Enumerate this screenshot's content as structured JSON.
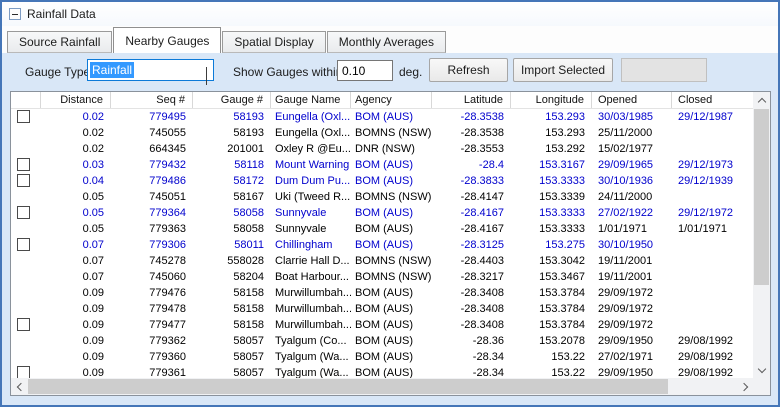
{
  "window": {
    "title": "Rainfall Data"
  },
  "tabs": [
    {
      "label": "Source Rainfall",
      "active": false
    },
    {
      "label": "Nearby Gauges",
      "active": true
    },
    {
      "label": "Spatial Display",
      "active": false
    },
    {
      "label": "Monthly Averages",
      "active": false
    }
  ],
  "toolbar": {
    "gauge_type_label": "Gauge Type",
    "gauge_type_value": "Rainfall",
    "show_within_label": "Show Gauges within",
    "show_within_value": "0.10",
    "unit_label": "deg.",
    "refresh_label": "Refresh",
    "import_label": "Import Selected"
  },
  "grid": {
    "columns": [
      "",
      "Distance",
      "Seq #",
      "Gauge #",
      "Gauge Name",
      "Agency",
      "Latitude",
      "Longitude",
      "Opened",
      "Closed"
    ],
    "rows": [
      {
        "selectable": true,
        "highlight": true,
        "distance": "0.02",
        "seq": "779495",
        "gauge_num": "58193",
        "gauge_name": "Eungella (Oxl...",
        "agency": "BOM (AUS)",
        "lat": "-28.3538",
        "lon": "153.293",
        "opened": "30/03/1985",
        "closed": "29/12/1987"
      },
      {
        "selectable": false,
        "highlight": false,
        "distance": "0.02",
        "seq": "745055",
        "gauge_num": "58193",
        "gauge_name": "Eungella (Oxl...",
        "agency": "BOMNS (NSW)",
        "lat": "-28.3538",
        "lon": "153.293",
        "opened": "25/11/2000",
        "closed": ""
      },
      {
        "selectable": false,
        "highlight": false,
        "distance": "0.02",
        "seq": "664345",
        "gauge_num": "201001",
        "gauge_name": "Oxley R @Eu...",
        "agency": "DNR (NSW)",
        "lat": "-28.3553",
        "lon": "153.292",
        "opened": "15/02/1977",
        "closed": ""
      },
      {
        "selectable": true,
        "highlight": true,
        "distance": "0.03",
        "seq": "779432",
        "gauge_num": "58118",
        "gauge_name": "Mount Warning",
        "agency": "BOM (AUS)",
        "lat": "-28.4",
        "lon": "153.3167",
        "opened": "29/09/1965",
        "closed": "29/12/1973"
      },
      {
        "selectable": true,
        "highlight": true,
        "distance": "0.04",
        "seq": "779486",
        "gauge_num": "58172",
        "gauge_name": "Dum Dum Pu...",
        "agency": "BOM (AUS)",
        "lat": "-28.3833",
        "lon": "153.3333",
        "opened": "30/10/1936",
        "closed": "29/12/1939"
      },
      {
        "selectable": false,
        "highlight": false,
        "distance": "0.05",
        "seq": "745051",
        "gauge_num": "58167",
        "gauge_name": "Uki (Tweed R...",
        "agency": "BOMNS (NSW)",
        "lat": "-28.4147",
        "lon": "153.3339",
        "opened": "24/11/2000",
        "closed": ""
      },
      {
        "selectable": true,
        "highlight": true,
        "distance": "0.05",
        "seq": "779364",
        "gauge_num": "58058",
        "gauge_name": "Sunnyvale",
        "agency": "BOM (AUS)",
        "lat": "-28.4167",
        "lon": "153.3333",
        "opened": "27/02/1922",
        "closed": "29/12/1972"
      },
      {
        "selectable": false,
        "highlight": false,
        "distance": "0.05",
        "seq": "779363",
        "gauge_num": "58058",
        "gauge_name": "Sunnyvale",
        "agency": "BOM (AUS)",
        "lat": "-28.4167",
        "lon": "153.3333",
        "opened": "1/01/1971",
        "closed": "1/01/1971"
      },
      {
        "selectable": true,
        "highlight": true,
        "distance": "0.07",
        "seq": "779306",
        "gauge_num": "58011",
        "gauge_name": "Chillingham",
        "agency": "BOM (AUS)",
        "lat": "-28.3125",
        "lon": "153.275",
        "opened": "30/10/1950",
        "closed": ""
      },
      {
        "selectable": false,
        "highlight": false,
        "distance": "0.07",
        "seq": "745278",
        "gauge_num": "558028",
        "gauge_name": "Clarrie Hall D...",
        "agency": "BOMNS (NSW)",
        "lat": "-28.4403",
        "lon": "153.3042",
        "opened": "19/11/2001",
        "closed": ""
      },
      {
        "selectable": false,
        "highlight": false,
        "distance": "0.07",
        "seq": "745060",
        "gauge_num": "58204",
        "gauge_name": "Boat Harbour...",
        "agency": "BOMNS (NSW)",
        "lat": "-28.3217",
        "lon": "153.3467",
        "opened": "19/11/2001",
        "closed": ""
      },
      {
        "selectable": false,
        "highlight": false,
        "distance": "0.09",
        "seq": "779476",
        "gauge_num": "58158",
        "gauge_name": "Murwillumbah...",
        "agency": "BOM (AUS)",
        "lat": "-28.3408",
        "lon": "153.3784",
        "opened": "29/09/1972",
        "closed": ""
      },
      {
        "selectable": false,
        "highlight": false,
        "distance": "0.09",
        "seq": "779478",
        "gauge_num": "58158",
        "gauge_name": "Murwillumbah...",
        "agency": "BOM (AUS)",
        "lat": "-28.3408",
        "lon": "153.3784",
        "opened": "29/09/1972",
        "closed": ""
      },
      {
        "selectable": true,
        "highlight": false,
        "distance": "0.09",
        "seq": "779477",
        "gauge_num": "58158",
        "gauge_name": "Murwillumbah...",
        "agency": "BOM (AUS)",
        "lat": "-28.3408",
        "lon": "153.3784",
        "opened": "29/09/1972",
        "closed": ""
      },
      {
        "selectable": false,
        "highlight": false,
        "distance": "0.09",
        "seq": "779362",
        "gauge_num": "58057",
        "gauge_name": "Tyalgum (Co...",
        "agency": "BOM (AUS)",
        "lat": "-28.36",
        "lon": "153.2078",
        "opened": "29/09/1950",
        "closed": "29/08/1992"
      },
      {
        "selectable": false,
        "highlight": false,
        "distance": "0.09",
        "seq": "779360",
        "gauge_num": "58057",
        "gauge_name": "Tyalgum (Wa...",
        "agency": "BOM (AUS)",
        "lat": "-28.34",
        "lon": "153.22",
        "opened": "27/02/1971",
        "closed": "29/08/1992"
      },
      {
        "selectable": true,
        "highlight": false,
        "distance": "0.09",
        "seq": "779361",
        "gauge_num": "58057",
        "gauge_name": "Tyalgum (Wa...",
        "agency": "BOM (AUS)",
        "lat": "-28.34",
        "lon": "153.22",
        "opened": "29/09/1950",
        "closed": "29/08/1992"
      }
    ]
  },
  "colors": {
    "window_border": "#4576b8",
    "panel_bg": "#d9e7f7",
    "highlight_row_text": "#0000cd",
    "combo_selection_bg": "#3399ff",
    "combo_focus_border": "#0c7ad8"
  }
}
